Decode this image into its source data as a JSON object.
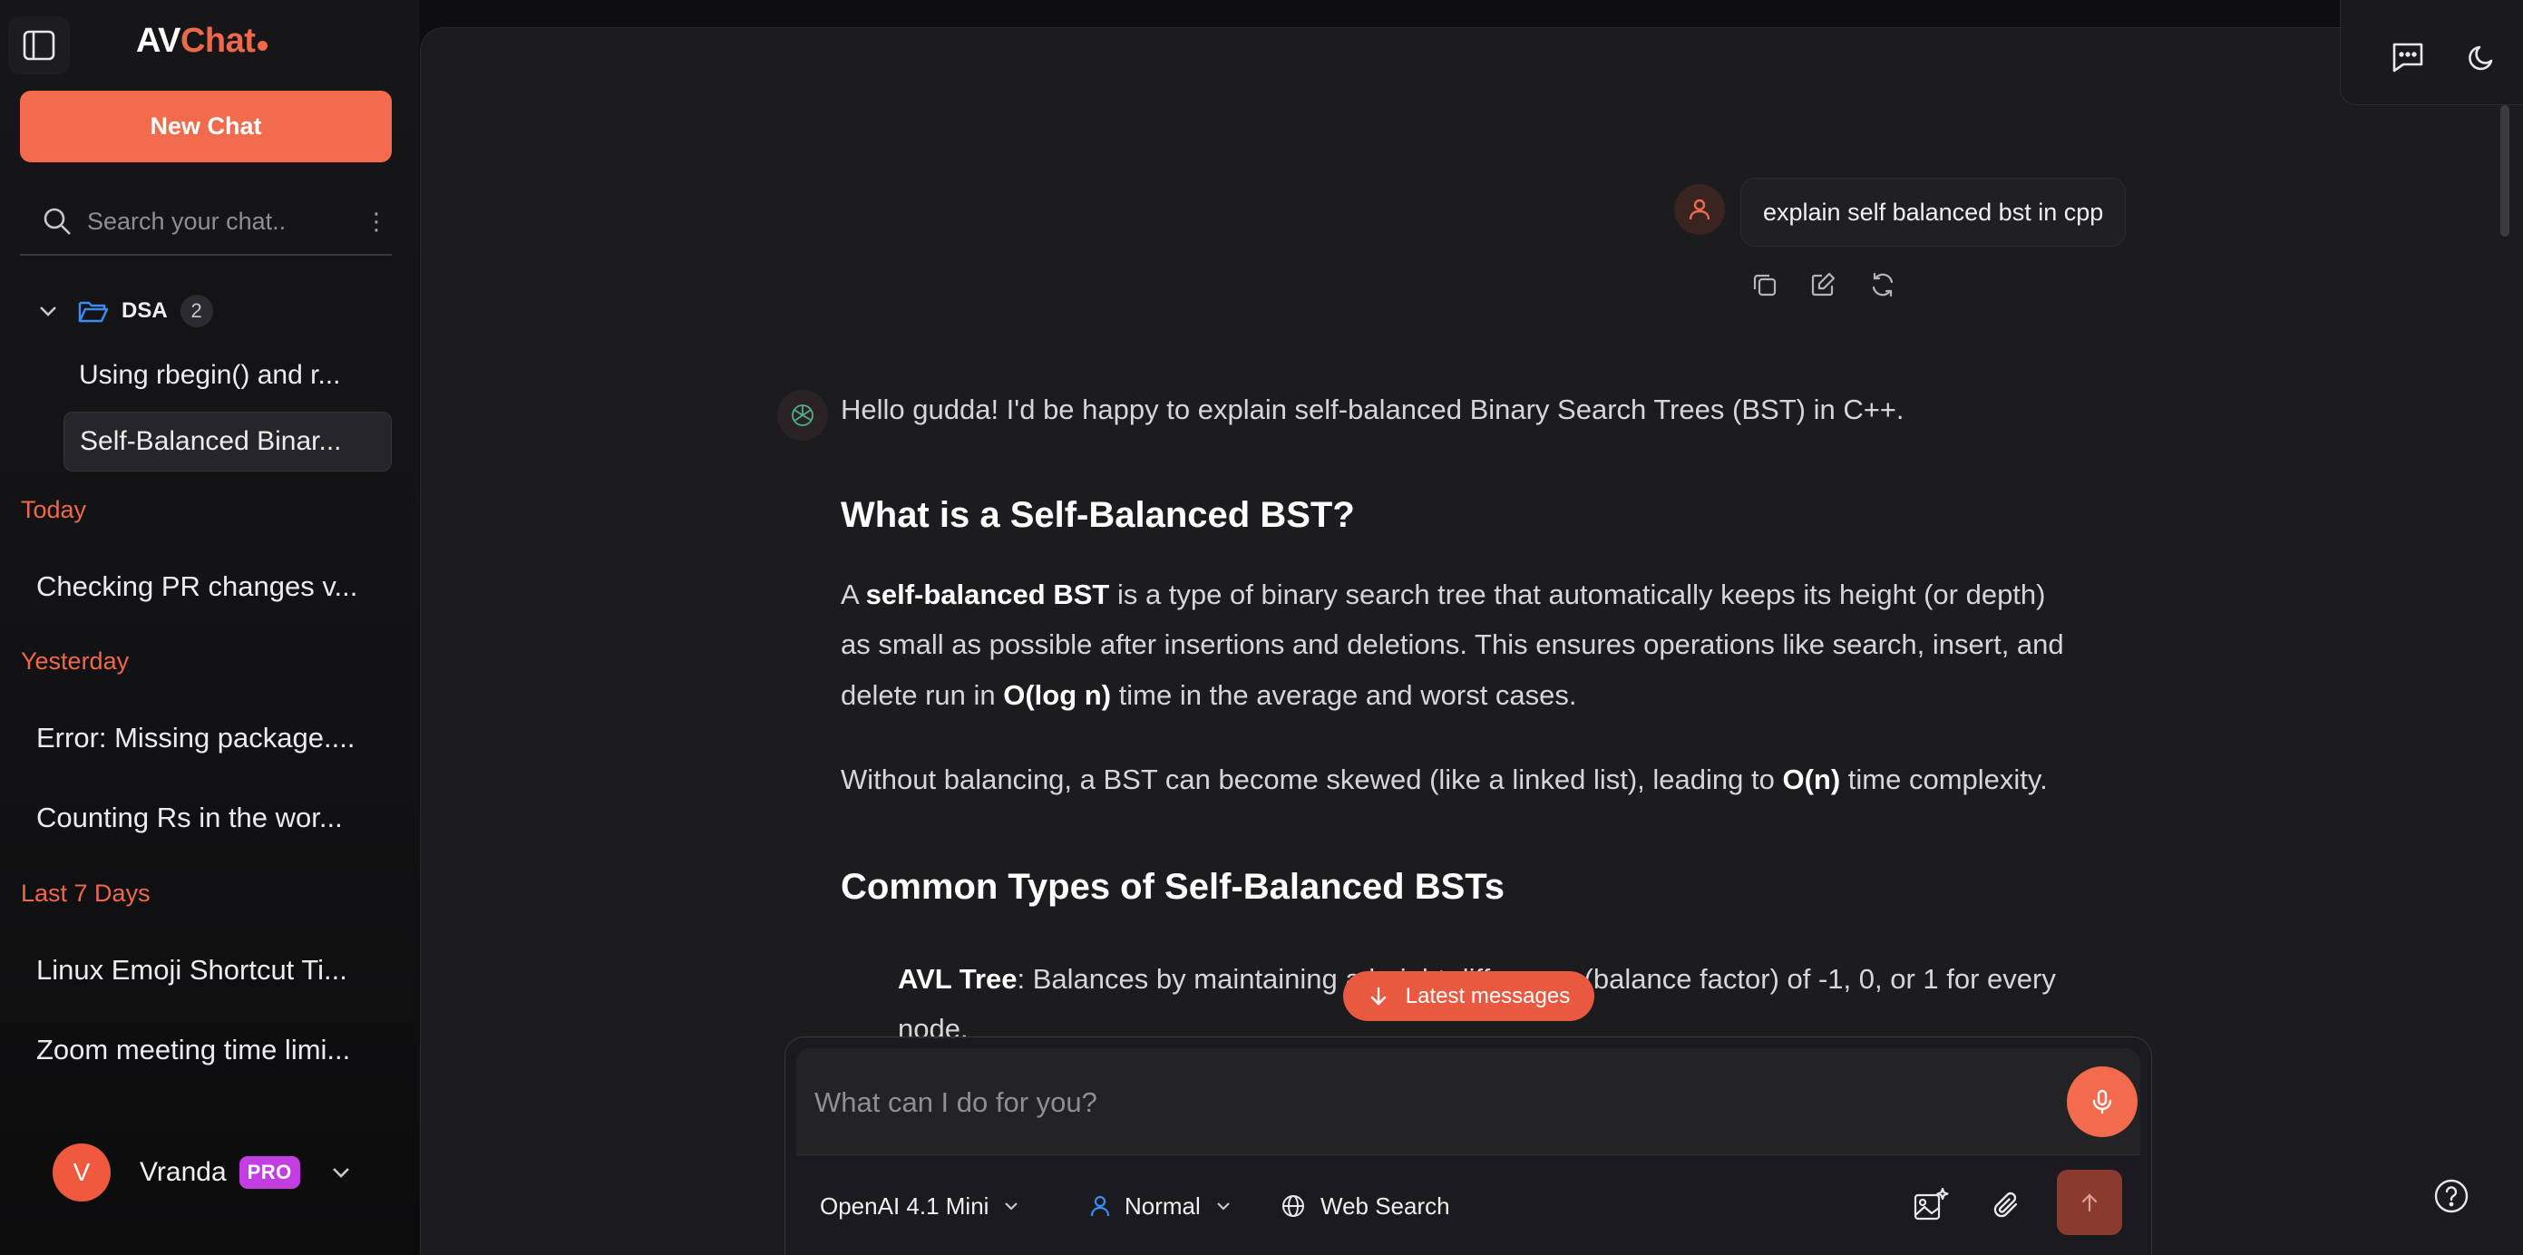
{
  "app": {
    "logo_main": "AV",
    "logo_accent": "Chat",
    "accent_color": "#f26b4d"
  },
  "sidebar": {
    "new_chat_label": "New Chat",
    "search_placeholder": "Search your chat..",
    "folder": {
      "name": "DSA",
      "count": "2",
      "items": [
        {
          "label": "Using rbegin() and r..."
        },
        {
          "label": "Self-Balanced Binar..."
        }
      ]
    },
    "sections": [
      {
        "label": "Today",
        "items": [
          "Checking PR changes v..."
        ]
      },
      {
        "label": "Yesterday",
        "items": [
          "Error: Missing package....",
          "Counting Rs in the wor..."
        ]
      },
      {
        "label": "Last 7 Days",
        "items": [
          "Linux Emoji Shortcut Ti...",
          "Zoom meeting time limi..."
        ]
      }
    ],
    "user": {
      "initial": "V",
      "name": "Vranda",
      "badge": "PRO"
    }
  },
  "conversation": {
    "user_message": "explain self balanced bst in cpp",
    "assistant": {
      "greeting": "Hello gudda! I'd be happy to explain self-balanced Binary Search Trees (BST) in C++.",
      "heading1": "What is a Self-Balanced BST?",
      "para1_a": "A ",
      "para1_b": "self-balanced BST",
      "para1_c": " is a type of binary search tree that automatically keeps its height (or depth)",
      "para1_line2": "as small as possible after insertions and deletions. This ensures operations like search, insert, and",
      "para1_line3_a": "delete run in ",
      "para1_line3_b": "O(log n)",
      "para1_line3_c": " time in the average and worst cases.",
      "para2_a": "Without balancing, a BST can become skewed (like a linked list), leading to ",
      "para2_b": "O(n)",
      "para2_c": " time complexity.",
      "heading2": "Common Types of Self-Balanced BSTs",
      "list1_a": "AVL Tree",
      "list1_b": ": Balances by maintaining a height difference (balance factor) of -1, 0, or 1 for every",
      "list1_line2": "node."
    }
  },
  "latest_messages_label": "Latest messages",
  "composer": {
    "placeholder": "What can I do for you?",
    "model_label": "OpenAI 4.1 Mini",
    "mode_label": "Normal",
    "web_search_label": "Web Search"
  }
}
